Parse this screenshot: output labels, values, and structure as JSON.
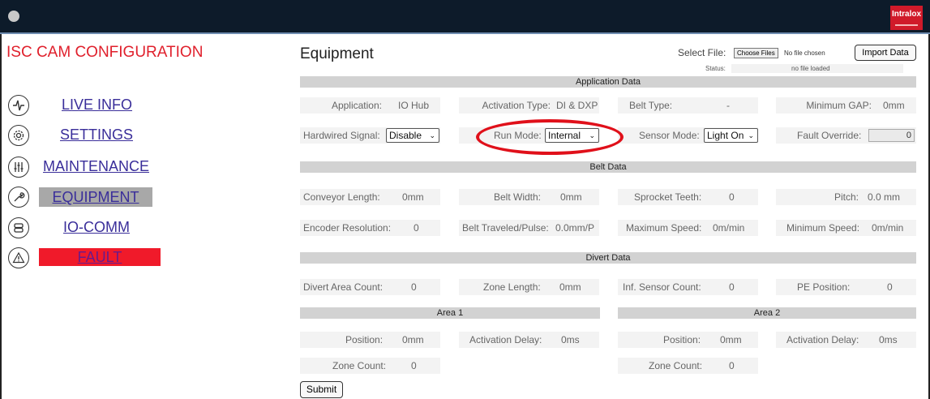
{
  "header": {
    "logo_text": "Intralox",
    "brand_color": "#d01a2a"
  },
  "sidebar": {
    "title": "ISC CAM CONFIGURATION",
    "items": [
      {
        "label": "LIVE INFO",
        "icon": "pulse-icon"
      },
      {
        "label": "SETTINGS",
        "icon": "gear-icon"
      },
      {
        "label": "MAINTENANCE",
        "icon": "sliders-icon"
      },
      {
        "label": "EQUIPMENT",
        "icon": "wrench-icon",
        "active": true
      },
      {
        "label": "IO-COMM",
        "icon": "server-icon"
      },
      {
        "label": "FAULT",
        "icon": "warning-icon",
        "alert_color": "#f01a2a"
      }
    ]
  },
  "main": {
    "title": "Equipment",
    "file": {
      "select_label": "Select File:",
      "choose_label": "Choose Files",
      "chosen_text": "No file chosen",
      "import_label": "Import Data",
      "status_label": "Status:",
      "status_value": "no file loaded"
    },
    "application": {
      "heading": "Application Data",
      "application_label": "Application:",
      "application_value": "IO Hub",
      "activation_type_label": "Activation Type:",
      "activation_type_value": "DI & DXP",
      "belt_type_label": "Belt Type:",
      "belt_type_value": "-",
      "minimum_gap_label": "Minimum GAP:",
      "minimum_gap_value": "0mm",
      "hardwired_label": "Hardwired Signal:",
      "hardwired_value": "Disable",
      "run_mode_label": "Run Mode:",
      "run_mode_value": "Internal",
      "sensor_mode_label": "Sensor Mode:",
      "sensor_mode_value": "Light On",
      "fault_override_label": "Fault Override:",
      "fault_override_value": "0"
    },
    "belt": {
      "heading": "Belt Data",
      "conveyor_length_label": "Conveyor Length:",
      "conveyor_length_value": "0mm",
      "belt_width_label": "Belt Width:",
      "belt_width_value": "0mm",
      "sprocket_teeth_label": "Sprocket Teeth:",
      "sprocket_teeth_value": "0",
      "pitch_label": "Pitch:",
      "pitch_value": "0.0 mm",
      "encoder_label": "Encoder Resolution:",
      "encoder_value": "0",
      "belt_traveled_label": "Belt Traveled/Pulse:",
      "belt_traveled_value": "0.0mm/P",
      "max_speed_label": "Maximum Speed:",
      "max_speed_value": "0m/min",
      "min_speed_label": "Minimum Speed:",
      "min_speed_value": "0m/min"
    },
    "divert": {
      "heading": "Divert Data",
      "area_count_label": "Divert Area Count:",
      "area_count_value": "0",
      "zone_length_label": "Zone Length:",
      "zone_length_value": "0mm",
      "inf_sensor_label": "Inf. Sensor Count:",
      "inf_sensor_value": "0",
      "pe_position_label": "PE Position:",
      "pe_position_value": "0"
    },
    "area1": {
      "heading": "Area 1",
      "position_label": "Position:",
      "position_value": "0mm",
      "activation_delay_label": "Activation Delay:",
      "activation_delay_value": "0ms",
      "zone_count_label": "Zone Count:",
      "zone_count_value": "0"
    },
    "area2": {
      "heading": "Area 2",
      "position_label": "Position:",
      "position_value": "0mm",
      "activation_delay_label": "Activation Delay:",
      "activation_delay_value": "0ms",
      "zone_count_label": "Zone Count:",
      "zone_count_value": "0"
    },
    "submit_label": "Submit"
  },
  "annotation_color": "#e0101a"
}
